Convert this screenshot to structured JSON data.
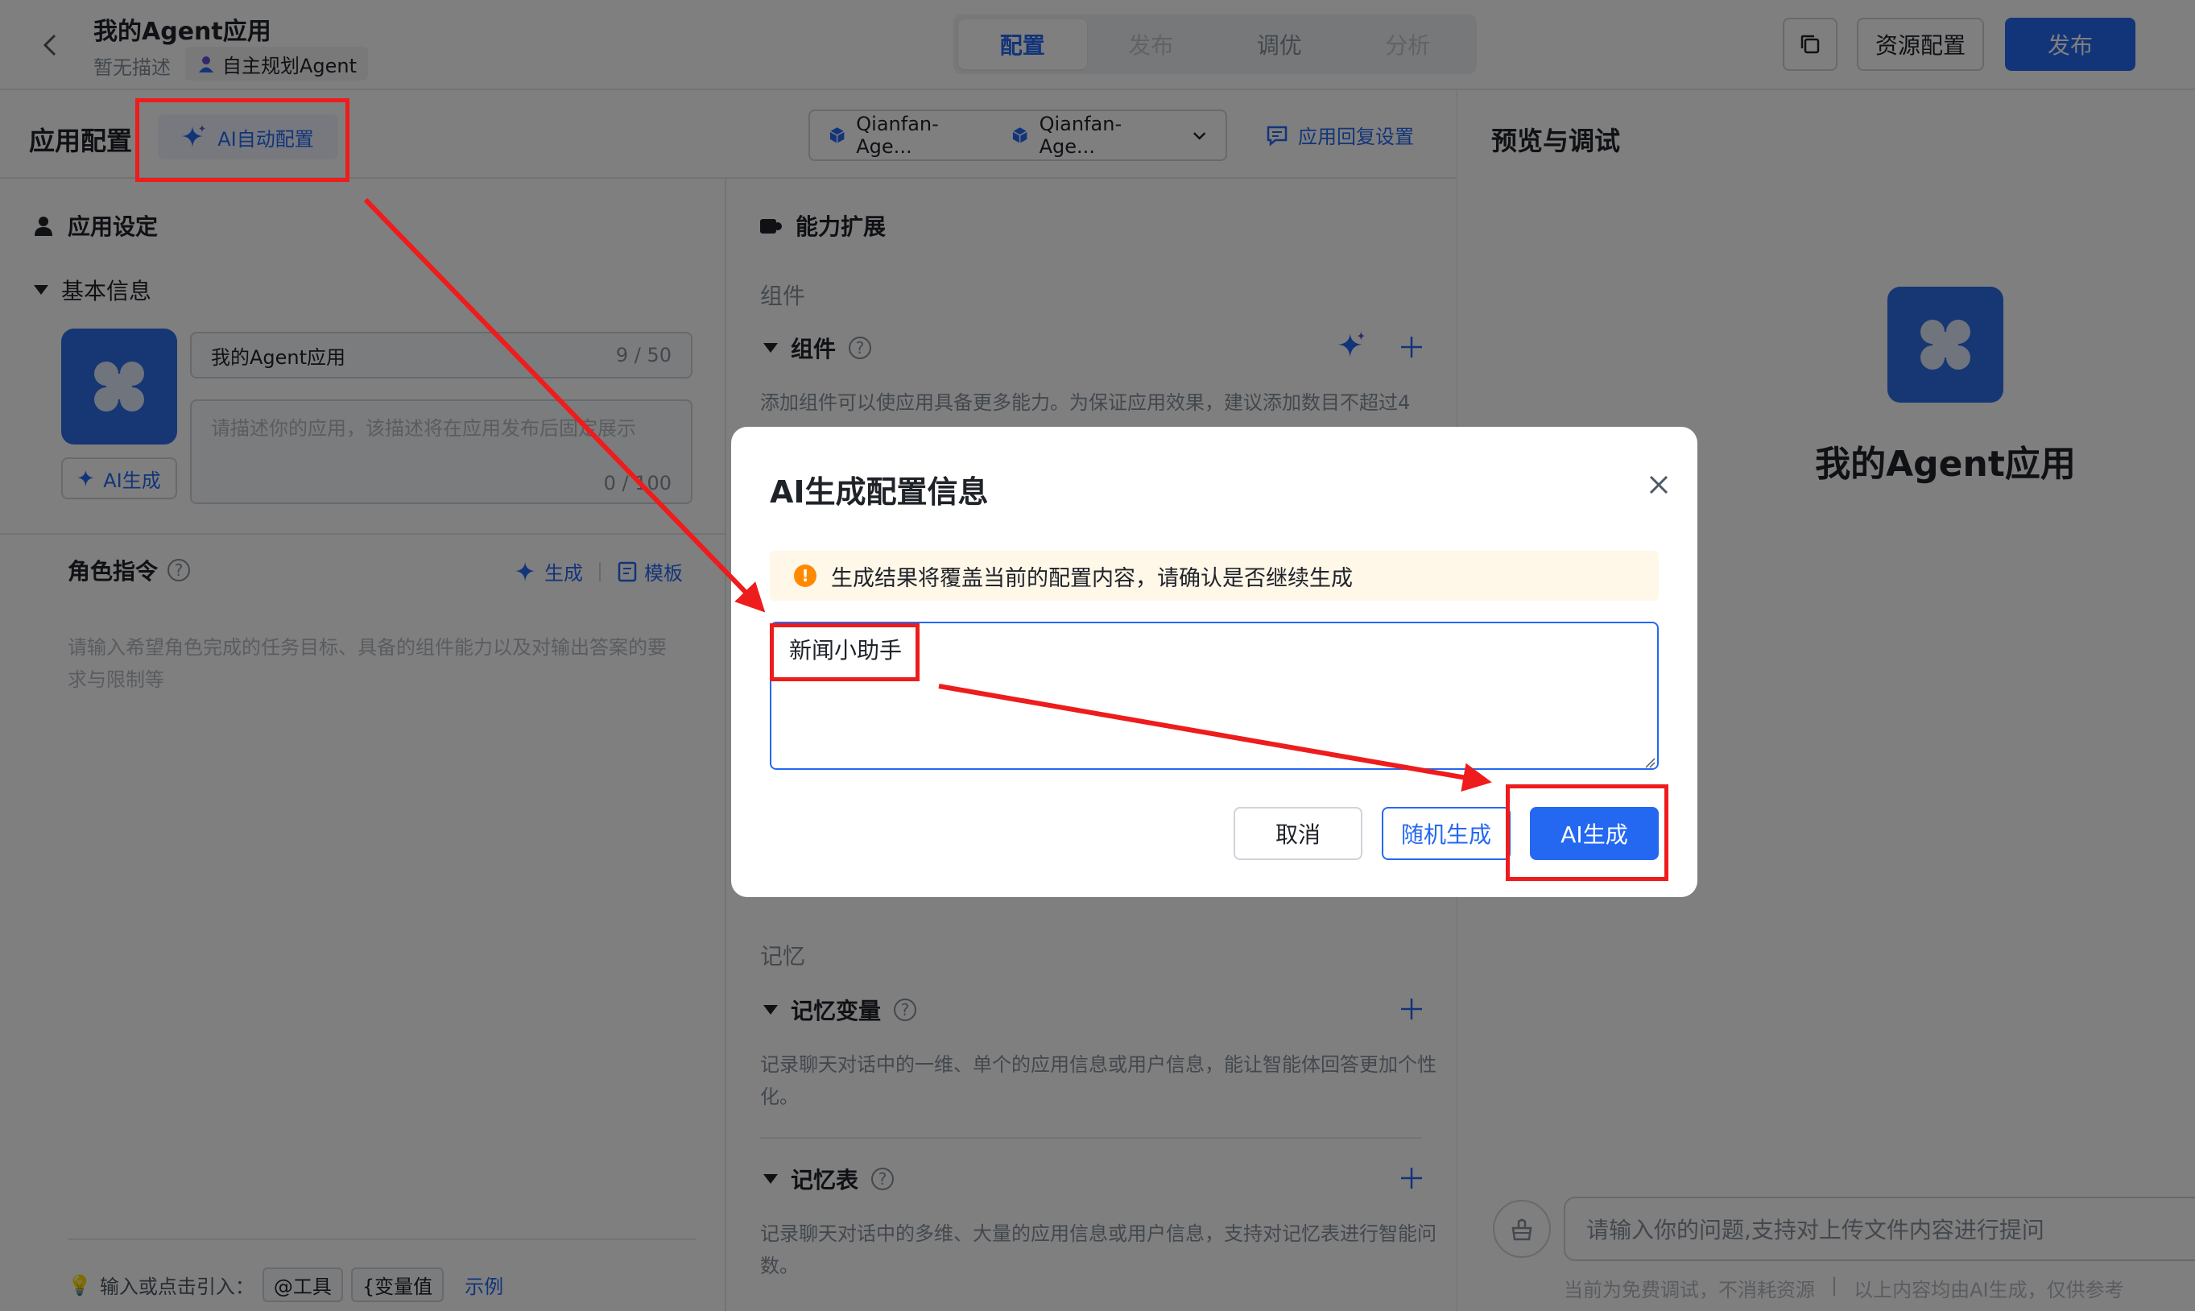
{
  "header": {
    "app_title": "我的Agent应用",
    "app_desc": "暂无描述",
    "agent_type": "自主规划Agent",
    "tabs": [
      {
        "label": "配置"
      },
      {
        "label": "发布"
      },
      {
        "label": "调优"
      },
      {
        "label": "分析"
      }
    ],
    "resource_config_label": "资源配置",
    "publish_label": "发布"
  },
  "config": {
    "title": "应用配置",
    "ai_auto_config_label": "AI自动配置",
    "models": [
      "Qianfan-Age...",
      "Qianfan-Age..."
    ],
    "reply_setting_label": "应用回复设置"
  },
  "app_settings": {
    "title": "应用设定",
    "basic_info_title": "基本信息",
    "name_value": "我的Agent应用",
    "name_count": "9 / 50",
    "desc_placeholder": "请描述你的应用，该描述将在应用发布后固定展示",
    "desc_count": "0 / 100",
    "ai_gen_label": "AI生成",
    "role_title": "角色指令",
    "role_generate_label": "生成",
    "role_template_label": "模板",
    "role_placeholder": "请输入希望角色完成的任务目标、具备的组件能力以及对输出答案的要求与限制等",
    "insert_hint": "输入或点击引入：",
    "chip_tool": "@工具",
    "chip_var": "{变量值",
    "example_label": "示例"
  },
  "capabilities": {
    "title": "能力扩展",
    "components_group": "组件",
    "components_title": "组件",
    "components_desc": "添加组件可以使应用具备更多能力。为保证应用效果，建议添加数目不超过4",
    "memory_group": "记忆",
    "memory_var_title": "记忆变量",
    "memory_var_desc": "记录聊天对话中的一维、单个的应用信息或用户信息，能让智能体回答更加个性化。",
    "memory_table_title": "记忆表",
    "memory_table_desc": "记录聊天对话中的多维、大量的应用信息或用户信息，支持对记忆表进行智能问数。"
  },
  "preview": {
    "title": "预览与调试",
    "app_name": "我的Agent应用",
    "chat_placeholder": "请输入你的问题,支持对上传文件内容进行提问",
    "note_free": "当前为免费调试，不消耗资源",
    "note_ai": "以上内容均由AI生成，仅供参考"
  },
  "dialog": {
    "title": "AI生成配置信息",
    "warning": "生成结果将覆盖当前的配置内容，请确认是否继续生成",
    "input_value": "新闻小助手",
    "cancel_label": "取消",
    "random_label": "随机生成",
    "ai_generate_label": "AI生成"
  },
  "colors": {
    "accent": "#2468f2",
    "warning": "#ff8a00",
    "annotation": "#ee1c1c"
  }
}
